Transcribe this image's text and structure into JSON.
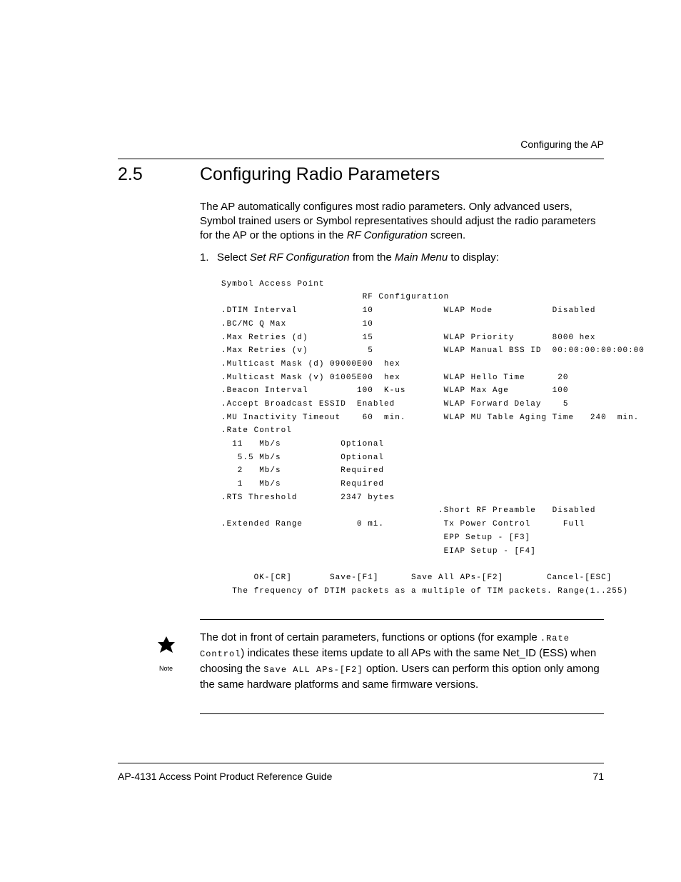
{
  "header": {
    "running_title": "Configuring the AP"
  },
  "section": {
    "number": "2.5",
    "title": "Configuring Radio Parameters",
    "intro_p1": "The AP automatically configures most radio parameters. Only advanced users, Symbol trained users or Symbol representatives should adjust the radio parameters for the AP or the options in the ",
    "intro_p1_em": "RF Configuration",
    "intro_p1_tail": " screen.",
    "step1_num": "1.",
    "step1_a": "Select ",
    "step1_em1": "Set RF Configuration",
    "step1_b": " from the ",
    "step1_em2": "Main Menu",
    "step1_c": " to display:"
  },
  "screen": {
    "line01": "Symbol Access Point",
    "line02": "                          RF Configuration",
    "line03": ".DTIM Interval            10             WLAP Mode           Disabled",
    "line04": ".BC/MC Q Max              10",
    "line05": ".Max Retries (d)          15             WLAP Priority       8000 hex",
    "line06": ".Max Retries (v)           5             WLAP Manual BSS ID  00:00:00:00:00:00",
    "line07": ".Multicast Mask (d) 09000E00  hex",
    "line08": ".Multicast Mask (v) 01005E00  hex        WLAP Hello Time      20",
    "line09": ".Beacon Interval         100  K-us       WLAP Max Age        100",
    "line10": ".Accept Broadcast ESSID  Enabled         WLAP Forward Delay    5",
    "line11": ".MU Inactivity Timeout    60  min.       WLAP MU Table Aging Time   240  min.",
    "line12": ".Rate Control",
    "line13": "  11   Mb/s           Optional",
    "line14": "   5.5 Mb/s           Optional",
    "line15": "   2   Mb/s           Required",
    "line16": "   1   Mb/s           Required",
    "line17": ".RTS Threshold        2347 bytes",
    "line18": "                                        .Short RF Preamble   Disabled",
    "line19": ".Extended Range          0 mi.           Tx Power Control      Full",
    "line20": "                                         EPP Setup - [F3]",
    "line21": "                                         EIAP Setup - [F4]",
    "line22": "",
    "line23": "      OK-[CR]       Save-[F1]      Save All APs-[F2]        Cancel-[ESC]",
    "line24": "  The frequency of DTIM packets as a multiple of TIM packets. Range(1..255)"
  },
  "note": {
    "label": "Note",
    "t1": "The dot in front of certain parameters, functions or options (for example ",
    "mono1": ".Rate Control",
    "t2": ") indicates these items update to all APs with the same Net_ID (ESS) when choosing the ",
    "mono2": "Save ALL APs-[F2]",
    "t3": " option. Users can perform this option only among the same hardware platforms and same firmware versions."
  },
  "footer": {
    "left": "AP-4131 Access Point Product Reference Guide",
    "right": "71"
  }
}
